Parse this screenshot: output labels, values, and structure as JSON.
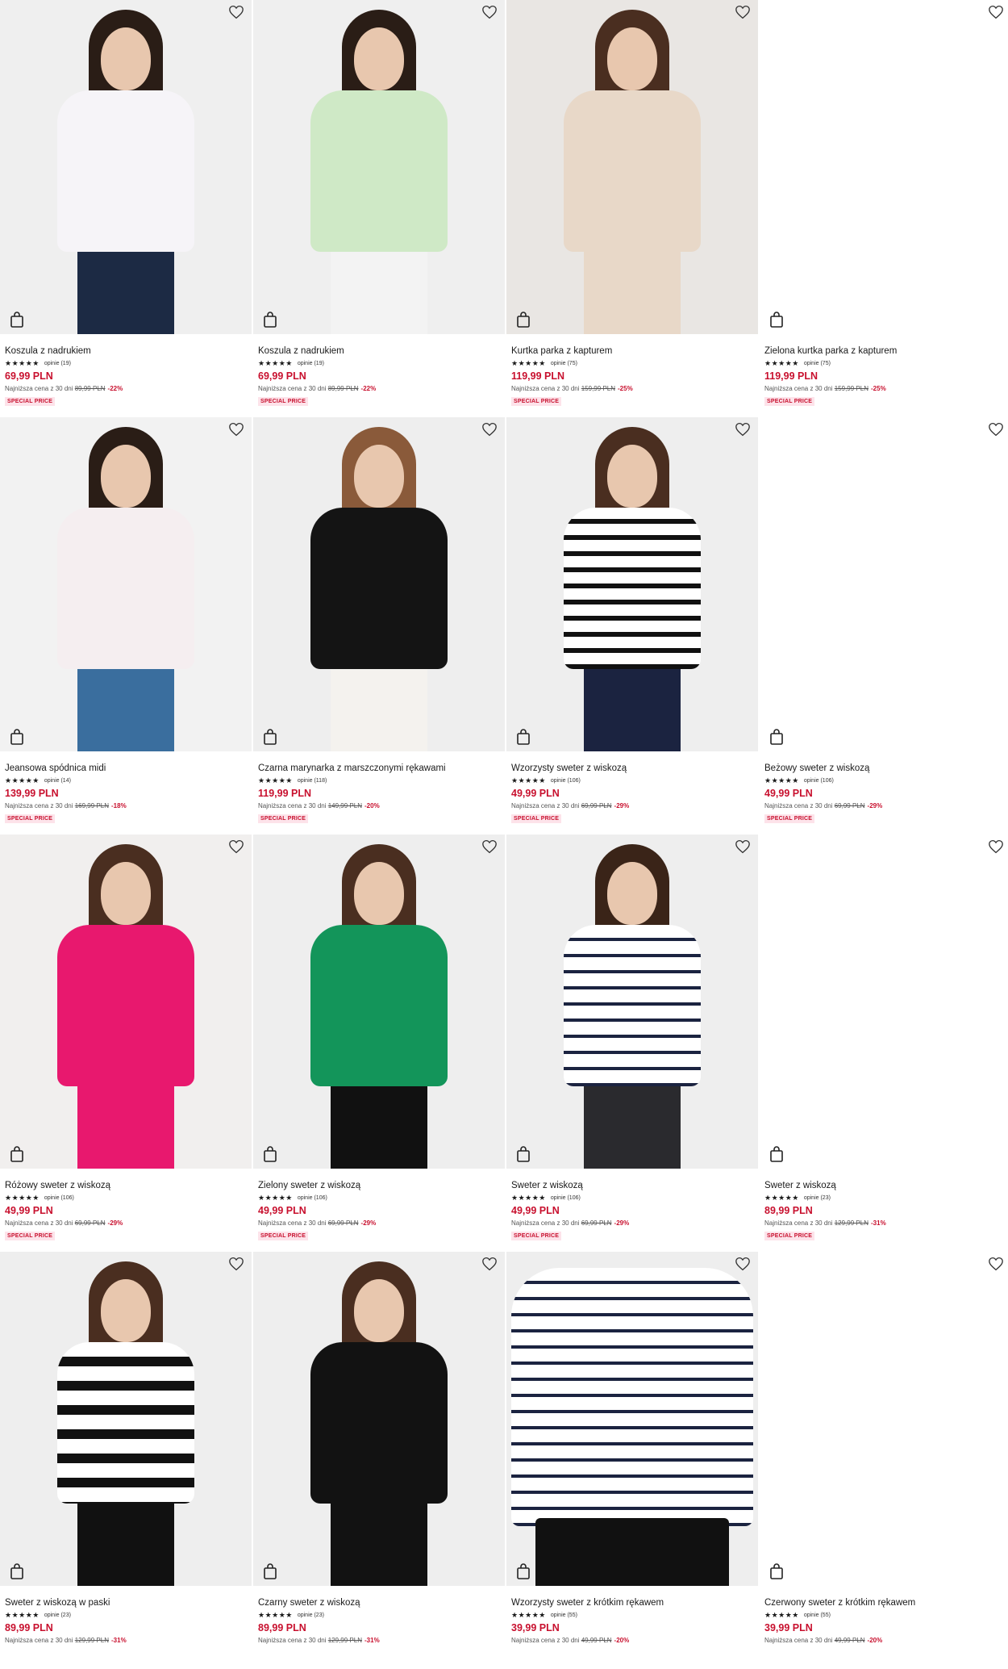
{
  "strings": {
    "lowest_prefix": "Najniższa cena z 30 dni",
    "currency": "PLN",
    "badge": "SPECIAL PRICE"
  },
  "products": [
    {
      "name": "Koszula z nadrukiem",
      "stars": "★★★★★",
      "rating": 4.5,
      "reviews": "opinie (19)",
      "price": "69,99 PLN",
      "old_price": "89,99 PLN",
      "discount": "-22%",
      "badge": "SPECIAL PRICE",
      "image": "floral-shirt",
      "visual": {
        "bg": "#efefef",
        "top": "#f6f4f8",
        "bottom": "#1c2a44",
        "hair": "#2a1d16"
      }
    },
    {
      "name": "Koszula z nadrukiem",
      "stars": "★★★★★",
      "rating": 4.5,
      "reviews": "opinie (19)",
      "price": "69,99 PLN",
      "old_price": "89,99 PLN",
      "discount": "-22%",
      "badge": "SPECIAL PRICE",
      "image": "colorful-shirt",
      "visual": {
        "bg": "#efefef",
        "top": "#cfe9c6",
        "bottom": "#f3f3f3",
        "hair": "#2a1d16"
      }
    },
    {
      "name": "Kurtka parka z kapturem",
      "stars": "★★★★★",
      "rating": 5,
      "reviews": "opinie (75)",
      "price": "119,99 PLN",
      "old_price": "159,99 PLN",
      "discount": "-25%",
      "badge": "SPECIAL PRICE",
      "image": "beige-parka",
      "visual": {
        "bg": "#e9e6e3",
        "top": "#e8d8c8",
        "bottom": "#e8d8c8",
        "hair": "#4a2e20"
      }
    },
    {
      "name": "Zielona kurtka parka z kapturem",
      "stars": "★★★★★",
      "rating": 5,
      "reviews": "opinie (75)",
      "price": "119,99 PLN",
      "old_price": "159,99 PLN",
      "discount": "-25%",
      "badge": "SPECIAL PRICE",
      "image": "blank",
      "visual": {
        "bg": "#ffffff",
        "blank": true
      }
    },
    {
      "name": "Jeansowa spódnica midi",
      "stars": "★★★★★",
      "rating": 5,
      "reviews": "opinie (14)",
      "price": "139,99 PLN",
      "old_price": "169,99 PLN",
      "discount": "-18%",
      "badge": "SPECIAL PRICE",
      "image": "denim-skirt",
      "visual": {
        "bg": "#f2f2f2",
        "top": "#f5eef0",
        "bottom": "#3a6e9e",
        "hair": "#2a1d16"
      }
    },
    {
      "name": "Czarna marynarka z marszczonymi rękawami",
      "stars": "★★★★★",
      "rating": 5,
      "reviews": "opinie (118)",
      "price": "119,99 PLN",
      "old_price": "149,99 PLN",
      "discount": "-20%",
      "badge": "SPECIAL PRICE",
      "image": "black-blazer",
      "visual": {
        "bg": "#eeeeee",
        "top": "#141414",
        "bottom": "#f4f2ee",
        "hair": "#8a5a3a"
      }
    },
    {
      "name": "Wzorzysty sweter z wiskozą",
      "stars": "★★★★★",
      "rating": 5,
      "reviews": "opinie (106)",
      "price": "49,99 PLN",
      "old_price": "69,99 PLN",
      "discount": "-29%",
      "badge": "SPECIAL PRICE",
      "image": "striped-sweater",
      "visual": {
        "bg": "#eeeeee",
        "top": "stripes",
        "bottom": "#1b2340",
        "hair": "#4a2e20"
      }
    },
    {
      "name": "Beżowy sweter z wiskozą",
      "stars": "★★★★★",
      "rating": 5,
      "reviews": "opinie (106)",
      "price": "49,99 PLN",
      "old_price": "69,99 PLN",
      "discount": "-29%",
      "badge": "SPECIAL PRICE",
      "image": "blank",
      "visual": {
        "bg": "#ffffff",
        "blank": true
      }
    },
    {
      "name": "Różowy sweter z wiskozą",
      "stars": "★★★★★",
      "rating": 5,
      "reviews": "opinie (106)",
      "price": "49,99 PLN",
      "old_price": "69,99 PLN",
      "discount": "-29%",
      "badge": "SPECIAL PRICE",
      "image": "pink-sweater",
      "visual": {
        "bg": "#f1efee",
        "top": "#e8186e",
        "bottom": "#e8186e",
        "hair": "#4a2e20"
      }
    },
    {
      "name": "Zielony sweter z wiskozą",
      "stars": "★★★★★",
      "rating": 5,
      "reviews": "opinie (106)",
      "price": "49,99 PLN",
      "old_price": "69,99 PLN",
      "discount": "-29%",
      "badge": "SPECIAL PRICE",
      "image": "green-sweater",
      "visual": {
        "bg": "#eeeeee",
        "top": "#13955a",
        "bottom": "#111111",
        "hair": "#4a2e20"
      }
    },
    {
      "name": "Sweter z wiskozą",
      "stars": "★★★★★",
      "rating": 5,
      "reviews": "opinie (106)",
      "price": "49,99 PLN",
      "old_price": "69,99 PLN",
      "discount": "-29%",
      "badge": "SPECIAL PRICE",
      "image": "navy-striped-sweater",
      "visual": {
        "bg": "#eeeeee",
        "top": "stripes-navy",
        "bottom": "#2a2a2e",
        "hair": "#3a2418"
      }
    },
    {
      "name": "Sweter z wiskozą",
      "stars": "★★★★★",
      "rating": 5,
      "reviews": "opinie (23)",
      "price": "89,99 PLN",
      "old_price": "129,99 PLN",
      "discount": "-31%",
      "badge": "SPECIAL PRICE",
      "image": "blank",
      "visual": {
        "bg": "#ffffff",
        "blank": true
      }
    },
    {
      "name": "Sweter z wiskozą w paski",
      "stars": "★★★★★",
      "rating": 5,
      "reviews": "opinie (23)",
      "price": "89,99 PLN",
      "old_price": "129,99 PLN",
      "discount": "-31%",
      "badge": "",
      "image": "black-white-striped-sweater",
      "visual": {
        "bg": "#eeeeee",
        "top": "stripes-black-wide",
        "bottom": "#111111",
        "hair": "#4a2e20"
      }
    },
    {
      "name": "Czarny sweter z wiskozą",
      "stars": "★★★★★",
      "rating": 5,
      "reviews": "opinie (23)",
      "price": "89,99 PLN",
      "old_price": "129,99 PLN",
      "discount": "-31%",
      "badge": "",
      "image": "black-sweater",
      "visual": {
        "bg": "#eeeeee",
        "top": "#121212",
        "bottom": "#121212",
        "hair": "#4a2e20"
      }
    },
    {
      "name": "Wzorzysty sweter z krótkim rękawem",
      "stars": "★★★★★",
      "rating": 5,
      "reviews": "opinie (55)",
      "price": "39,99 PLN",
      "old_price": "49,99 PLN",
      "discount": "-20%",
      "badge": "",
      "image": "short-sleeve-striped",
      "visual": {
        "bg": "#eeeeee",
        "top": "stripes-navy",
        "bottom": "#111111",
        "hair": "#2a1d16",
        "closeup": true
      }
    },
    {
      "name": "Czerwony sweter z krótkim rękawem",
      "stars": "★★★★★",
      "rating": 5,
      "reviews": "opinie (55)",
      "price": "39,99 PLN",
      "old_price": "49,99 PLN",
      "discount": "-20%",
      "badge": "",
      "image": "blank",
      "visual": {
        "bg": "#ffffff",
        "blank": true
      }
    }
  ]
}
